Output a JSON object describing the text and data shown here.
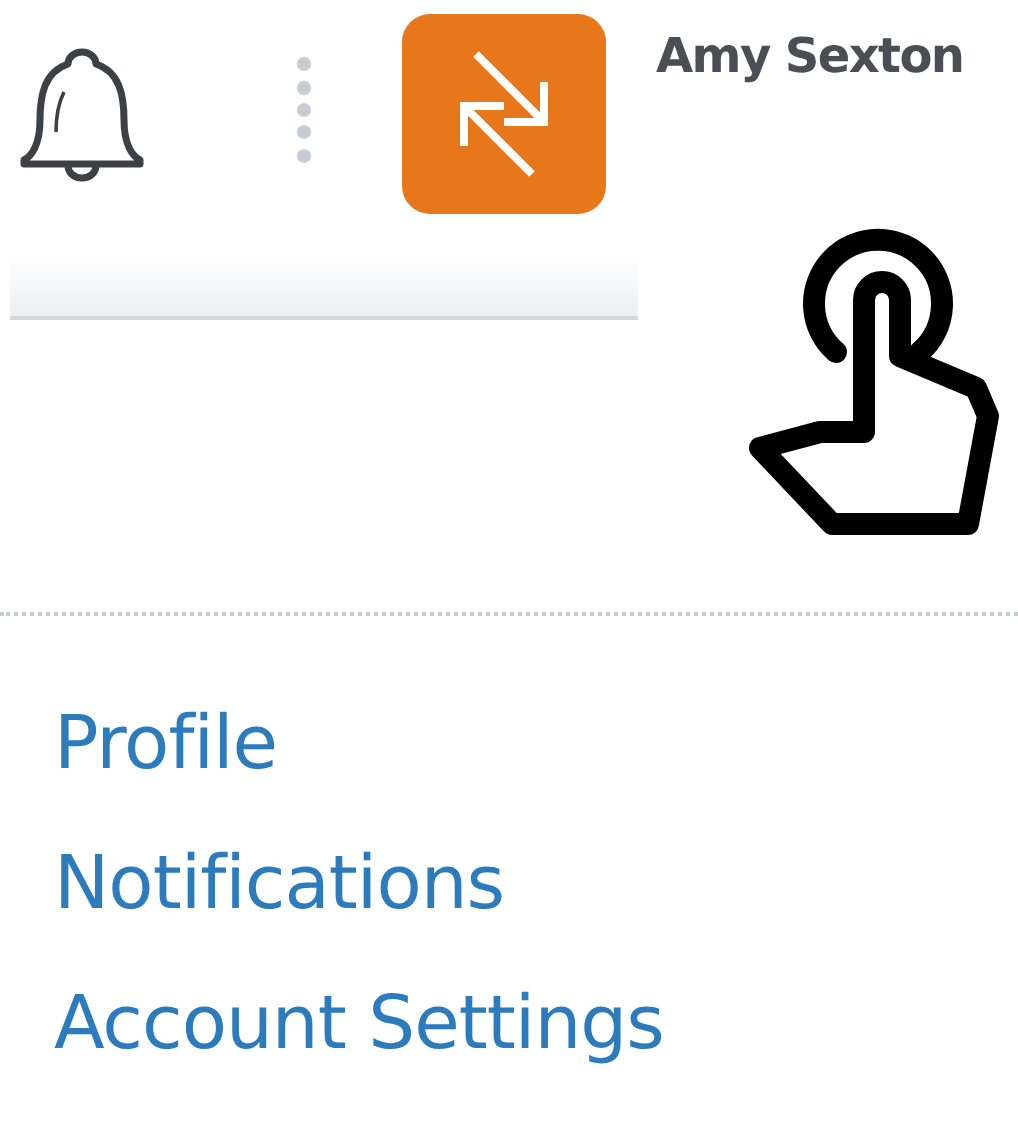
{
  "user": {
    "name": "Amy Sexton"
  },
  "menu": [
    {
      "label": "Profile"
    },
    {
      "label": "Notifications"
    },
    {
      "label": "Account Settings"
    }
  ]
}
